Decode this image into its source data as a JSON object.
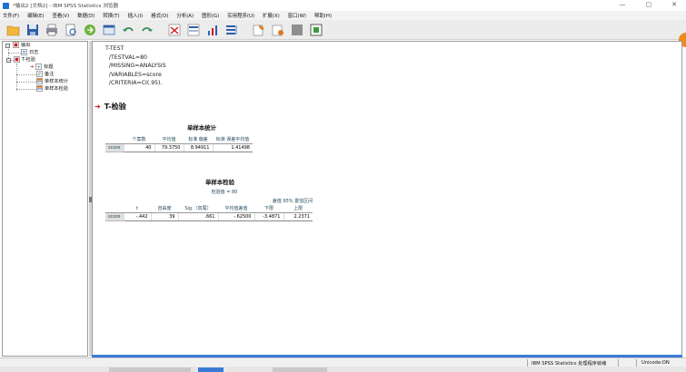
{
  "window": {
    "title": "*输出2 [文档2] - IBM SPSS Statistics 浏览器",
    "controls": [
      "—",
      "▢",
      "✕"
    ]
  },
  "menu": [
    "文件(F)",
    "编辑(E)",
    "查看(V)",
    "数据(D)",
    "转换(T)",
    "插入(I)",
    "格式(O)",
    "分析(A)",
    "图形(G)",
    "实用程序(U)",
    "扩展(X)",
    "窗口(W)",
    "帮助(H)"
  ],
  "toolbar": {
    "icons": [
      "open-folder-icon",
      "save-icon",
      "print-icon",
      "print-preview-icon",
      "export-icon",
      "recall-dialog-icon",
      "undo-icon",
      "redo-icon",
      "goto-data-icon",
      "goto-case-icon",
      "goto-variable-icon",
      "variables-icon",
      "designate-window-icon",
      "show-all-icon",
      "insert-output-icon",
      "pivot-icon"
    ]
  },
  "tree": {
    "root": "输出",
    "log": "日志",
    "ttest": "T-检验",
    "heading": "标题",
    "notes": "备注",
    "stats": "单样本统计",
    "test": "单样本检验"
  },
  "syntax": [
    "T-TEST",
    "  /TESTVAL=80",
    "  /MISSING=ANALYSIS",
    "  /VARIABLES=score",
    "  /CRITERIA=CI(.95)."
  ],
  "section_title": "T-检验",
  "stats_table": {
    "title": "单样本统计",
    "headers": [
      "个案数",
      "平均值",
      "标准 偏差",
      "标准 误差平均值"
    ],
    "row_label": "score",
    "values": [
      "40",
      "79.3750",
      "8.94911",
      "1.41498"
    ]
  },
  "test_table": {
    "title": "单样本检验",
    "caption": "检验值 = 80",
    "ci_header": "差值 95% 置信区间",
    "headers": [
      "t",
      "自由度",
      "Sig.（双尾）",
      "平均值差值",
      "下限",
      "上限"
    ],
    "row_label": "score",
    "values": [
      "-.442",
      "39",
      ".661",
      "-.62500",
      "-3.4871",
      "2.2371"
    ]
  },
  "status": {
    "processor": "IBM SPSS Statistics 处理程序就绪",
    "unicode": "Unicode:ON"
  }
}
